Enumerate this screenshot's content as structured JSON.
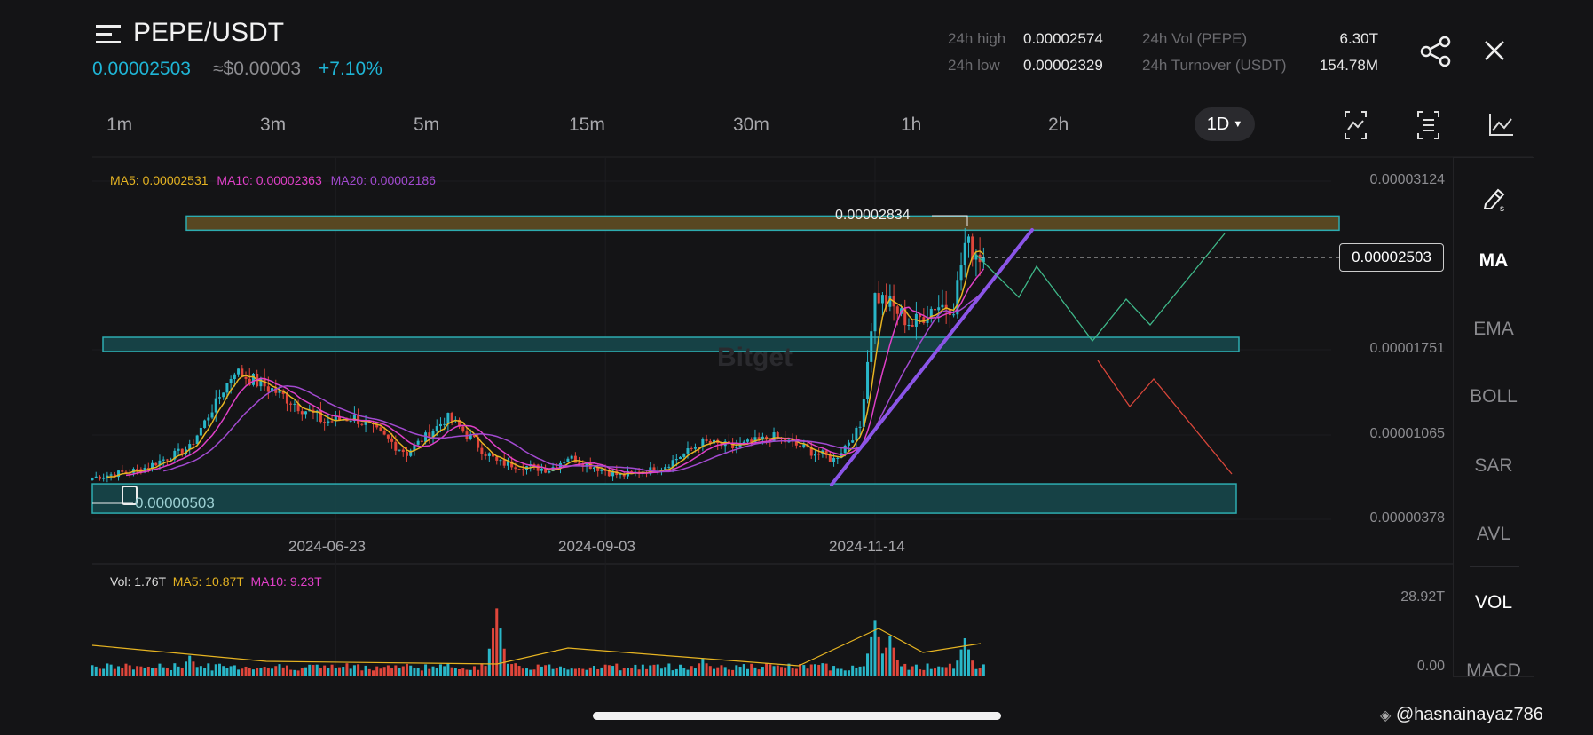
{
  "header": {
    "pair": "PEPE/USDT",
    "last_price": "0.00002503",
    "usd_price": "≈$0.00003",
    "change": "+7.10%",
    "stats": {
      "high_label": "24h high",
      "high_value": "0.00002574",
      "low_label": "24h low",
      "low_value": "0.00002329",
      "vol_label": "24h Vol (PEPE)",
      "vol_value": "6.30T",
      "turnover_label": "24h Turnover (USDT)",
      "turnover_value": "154.78M"
    }
  },
  "timeframes": [
    "1m",
    "3m",
    "5m",
    "15m",
    "30m",
    "1h",
    "2h"
  ],
  "selected_timeframe": "1D",
  "ma_legend": {
    "ma5": "MA5: 0.00002531",
    "ma10": "MA10: 0.00002363",
    "ma20": "MA20: 0.00002186"
  },
  "vol_legend": {
    "vol": "Vol: 1.76T",
    "ma5": "MA5: 10.87T",
    "ma10": "MA10: 9.23T"
  },
  "indicators": [
    "MA",
    "EMA",
    "BOLL",
    "SAR",
    "AVL",
    "VOL",
    "MACD"
  ],
  "watermark": "Bitget",
  "credit": "@hasnainayaz786",
  "colors": {
    "up": "#29b6c8",
    "down": "#e0463b",
    "ma5": "#e6b422",
    "ma10": "#e040c8",
    "ma20": "#a24ad0",
    "accent": "#1fb5d6"
  },
  "chart_data": {
    "type": "candlestick",
    "y_ticks": [
      "0.00003124",
      "0.00001751",
      "0.00001065",
      "0.00000378"
    ],
    "y_tick_values": [
      3124,
      1751,
      1065,
      378
    ],
    "price_unit": "1e-8 USDT",
    "x_ticks": [
      {
        "label": "2024-06-23",
        "index": 65
      },
      {
        "label": "2024-09-03",
        "index": 137
      },
      {
        "label": "2024-11-14",
        "index": 209
      }
    ],
    "current_price_label": "0.00002503",
    "current_price": 2503,
    "high_marker_label": "0.00002834",
    "low_marker_label": "0.00000503",
    "candle_count": 239,
    "close_keypoints": [
      [
        0,
        716
      ],
      [
        13,
        781
      ],
      [
        26,
        961
      ],
      [
        38,
        1581
      ],
      [
        49,
        1415
      ],
      [
        62,
        1170
      ],
      [
        70,
        1206
      ],
      [
        84,
        918
      ],
      [
        95,
        1206
      ],
      [
        108,
        838
      ],
      [
        122,
        781
      ],
      [
        127,
        882
      ],
      [
        141,
        730
      ],
      [
        152,
        795
      ],
      [
        163,
        1004
      ],
      [
        171,
        961
      ],
      [
        182,
        1047
      ],
      [
        198,
        860
      ],
      [
        205,
        1127
      ],
      [
        209,
        2201
      ],
      [
        213,
        2115
      ],
      [
        219,
        1956
      ],
      [
        225,
        2115
      ],
      [
        230,
        2115
      ],
      [
        233,
        2612
      ],
      [
        238,
        2503
      ]
    ],
    "zones": [
      {
        "name": "resistance",
        "top": 2840,
        "bottom": 2725,
        "color": "#5c4a22"
      },
      {
        "name": "support-mid",
        "top": 1855,
        "bottom": 1740,
        "color": "#174448"
      },
      {
        "name": "support-low",
        "top": 665,
        "bottom": 427,
        "color": "#174448"
      }
    ],
    "volume_axis": [
      "28.92T",
      "0.00"
    ],
    "volume_max": 28.92,
    "volume_spikes": [
      [
        108,
        27
      ],
      [
        209,
        22
      ],
      [
        213,
        16
      ],
      [
        233,
        15
      ],
      [
        26,
        8
      ],
      [
        163,
        7
      ]
    ]
  }
}
